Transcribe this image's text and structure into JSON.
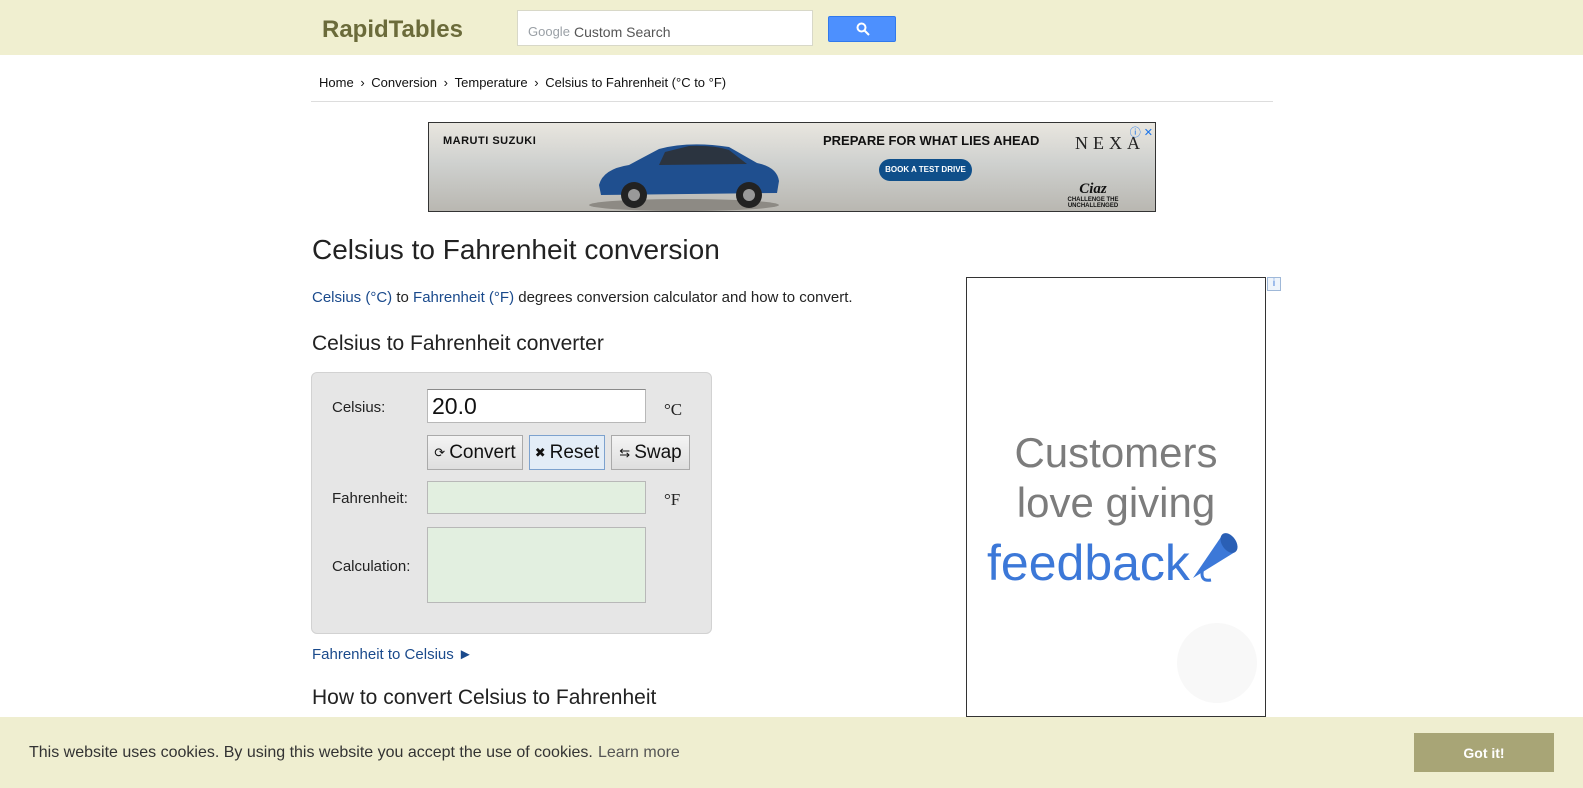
{
  "header": {
    "logo": "RapidTables",
    "search": {
      "brand": "Google",
      "placeholder": "Custom Search",
      "button_icon": "search-icon"
    }
  },
  "breadcrumb": [
    "Home",
    "Conversion",
    "Temperature",
    "Celsius to Fahrenheit (°C to °F)"
  ],
  "ad_top": {
    "brand": "MARUTI SUZUKI",
    "headline": "PREPARE FOR WHAT LIES AHEAD",
    "cta": "BOOK A TEST DRIVE",
    "logo_right": "NEXA",
    "model": "Ciaz",
    "tagline": "CHALLENGE THE UNCHALLENGED"
  },
  "page": {
    "title": "Celsius to Fahrenheit conversion",
    "intro": {
      "link_celsius": "Celsius (°C)",
      "to": "to",
      "link_fahrenheit": "Fahrenheit (°F)",
      "rest": "degrees conversion calculator and how to convert."
    },
    "converter_heading": "Celsius to Fahrenheit converter",
    "how_heading": "How to convert Celsius to Fahrenheit",
    "reverse_link": "Fahrenheit to Celsius ►"
  },
  "converter": {
    "celsius_label": "Celsius:",
    "celsius_value": "20.0",
    "celsius_unit": "°C",
    "fahrenheit_label": "Fahrenheit:",
    "fahrenheit_value": "",
    "fahrenheit_unit": "°F",
    "calculation_label": "Calculation:",
    "calculation_value": "",
    "buttons": {
      "convert": "Convert",
      "reset": "Reset",
      "swap": "Swap"
    },
    "icons": {
      "convert": "refresh-icon",
      "reset": "close-icon",
      "swap": "swap-icon"
    }
  },
  "ad_right": {
    "line1": "Customers",
    "line2": "love giving",
    "line3": "feedback"
  },
  "cookie_banner": {
    "message": "This website uses cookies. By using this website you accept the use of cookies.",
    "learn_more": "Learn more",
    "accept": "Got it!"
  },
  "colors": {
    "topbar": "#f0efd0",
    "logo": "#6b6b3a",
    "link": "#1a4a8c",
    "result_field": "#e2efe0",
    "cookie_button": "#a8a576"
  }
}
